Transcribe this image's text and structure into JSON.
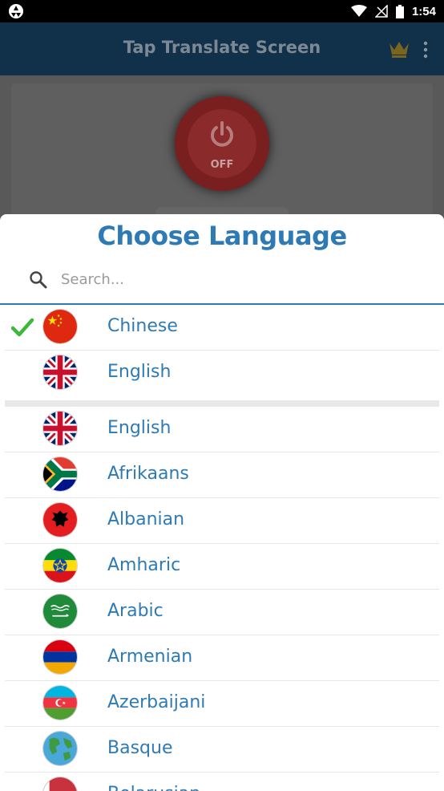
{
  "status_bar": {
    "time": "1:54"
  },
  "app_bar": {
    "title": "Tap Translate Screen"
  },
  "power_button": {
    "state_label": "OFF"
  },
  "dialog": {
    "title": "Choose Language",
    "search": {
      "placeholder": "Search...",
      "value": ""
    },
    "selected_language": "Chinese",
    "recent_languages": [
      {
        "label": "Chinese",
        "flag": "china-flag-icon",
        "selected": true
      },
      {
        "label": "English",
        "flag": "uk-flag-icon",
        "selected": false
      }
    ],
    "all_languages": [
      {
        "label": "English",
        "flag": "uk-flag-icon"
      },
      {
        "label": "Afrikaans",
        "flag": "south-africa-flag-icon"
      },
      {
        "label": "Albanian",
        "flag": "albania-flag-icon"
      },
      {
        "label": "Amharic",
        "flag": "ethiopia-flag-icon"
      },
      {
        "label": "Arabic",
        "flag": "saudi-arabia-flag-icon"
      },
      {
        "label": "Armenian",
        "flag": "armenia-flag-icon"
      },
      {
        "label": "Azerbaijani",
        "flag": "azerbaijan-flag-icon"
      },
      {
        "label": "Basque",
        "flag": "globe-icon"
      },
      {
        "label": "Belarusian",
        "flag": "belarus-flag-icon"
      }
    ]
  },
  "colors": {
    "accent": "#2d7ab5",
    "check": "#3cb93c",
    "app_bar": "#11314b"
  }
}
